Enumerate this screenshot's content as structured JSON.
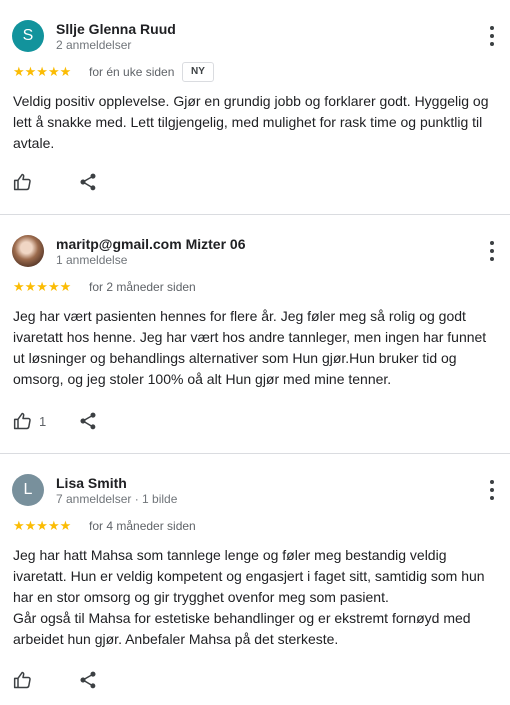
{
  "reviews": [
    {
      "avatar_letter": "S",
      "avatar_color": "#12939c",
      "name": "Sllje Glenna Ruud",
      "meta": "2 anmeldelser",
      "rating": 5,
      "stars": "★★★★★",
      "date": "for én uke siden",
      "badge": "NY",
      "text": [
        "Veldig positiv opplevelse. Gjør en grundig jobb og forklarer godt. Hyggelig og lett å snakke med. Lett tilgjengelig, med mulighet for rask time og punktlig til avtale."
      ],
      "likes": ""
    },
    {
      "avatar_letter": "",
      "name": "maritp@gmail.com Mizter 06",
      "meta": "1 anmeldelse",
      "rating": 5,
      "stars": "★★★★★",
      "date": "for 2 måneder siden",
      "text": [
        "Jeg har vært pasienten hennes for flere år. Jeg føler meg så rolig og godt ivaretatt hos henne. Jeg har vært hos andre tannleger, men ingen har funnet ut løsninger og behandlings alternativer som Hun gjør.Hun bruker tid og omsorg, og jeg stoler 100% oå alt Hun gjør med mine tenner."
      ],
      "likes": "1"
    },
    {
      "avatar_letter": "L",
      "avatar_color": "#78909c",
      "name": "Lisa Smith",
      "meta": "7 anmeldelser · 1 bilde",
      "rating": 5,
      "stars": "★★★★★",
      "date": "for 4 måneder siden",
      "text": [
        "Jeg har hatt Mahsa som tannlege lenge og føler meg bestandig veldig ivaretatt. Hun er veldig kompetent og engasjert i faget sitt, samtidig som hun har en stor omsorg og gir trygghet ovenfor meg som pasient.",
        "Går også til Mahsa for estetiske behandlinger og er ekstremt fornøyd med arbeidet hun gjør. Anbefaler Mahsa på det sterkeste."
      ],
      "likes": ""
    }
  ],
  "icons": {
    "like": "thumbs-up-icon",
    "share": "share-icon",
    "more": "more-vert-icon",
    "star": "star-icon"
  }
}
